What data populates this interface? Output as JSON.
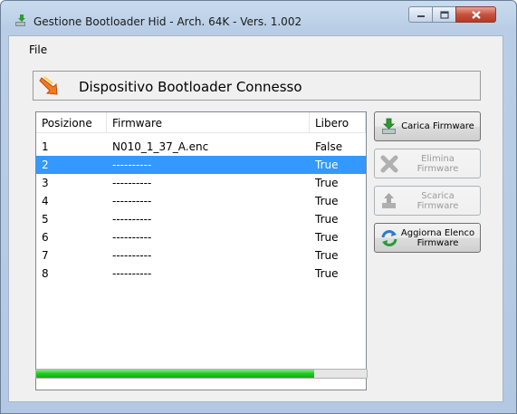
{
  "window": {
    "title": "Gestione Bootloader Hid - Arch. 64K - Vers. 1.002"
  },
  "menu": {
    "file_label": "File"
  },
  "status": {
    "text": "Dispositivo Bootloader Connesso"
  },
  "list": {
    "headers": {
      "position": "Posizione",
      "firmware": "Firmware",
      "free": "Libero"
    },
    "rows": [
      {
        "position": "1",
        "firmware": "N010_1_37_A.enc",
        "free": "False",
        "selected": false
      },
      {
        "position": "2",
        "firmware": "----------",
        "free": "True",
        "selected": true
      },
      {
        "position": "3",
        "firmware": "----------",
        "free": "True",
        "selected": false
      },
      {
        "position": "4",
        "firmware": "----------",
        "free": "True",
        "selected": false
      },
      {
        "position": "5",
        "firmware": "----------",
        "free": "True",
        "selected": false
      },
      {
        "position": "6",
        "firmware": "----------",
        "free": "True",
        "selected": false
      },
      {
        "position": "7",
        "firmware": "----------",
        "free": "True",
        "selected": false
      },
      {
        "position": "8",
        "firmware": "----------",
        "free": "True",
        "selected": false
      }
    ]
  },
  "buttons": {
    "load": {
      "label": "Carica Firmware",
      "icon": "load-firmware-icon",
      "enabled": true
    },
    "delete": {
      "label": "Elimina Firmware",
      "icon": "delete-icon",
      "enabled": false
    },
    "download": {
      "label": "Scarica Firmware",
      "icon": "download-firmware-icon",
      "enabled": false
    },
    "refresh": {
      "label": "Aggiorna Elenco Firmware",
      "icon": "refresh-icon",
      "enabled": true
    }
  },
  "progress": {
    "fraction": 0.84
  },
  "colors": {
    "selection": "#3399ff",
    "progress": "#1fc81f",
    "accent_icon": "#f08020"
  }
}
